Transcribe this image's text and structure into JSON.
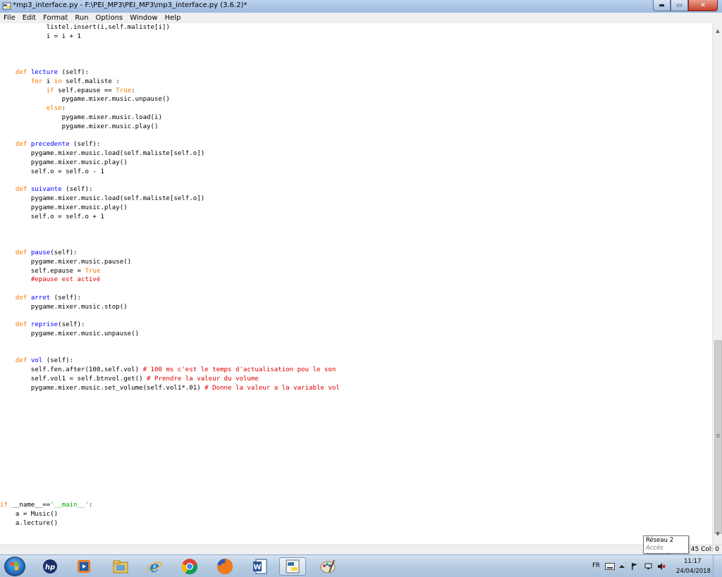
{
  "window": {
    "title": "*mp3_interface.py - F:\\PEI_MP3\\PEI_MP3\\mp3_interface.py (3.6.2)*",
    "controls": {
      "minimize": "▬",
      "maximize": "▭",
      "close": "✕"
    }
  },
  "menu": {
    "items": [
      {
        "label": "File"
      },
      {
        "label": "Edit"
      },
      {
        "label": "Format"
      },
      {
        "label": "Run"
      },
      {
        "label": "Options"
      },
      {
        "label": "Window"
      },
      {
        "label": "Help"
      }
    ]
  },
  "code_lines": [
    [
      [
        "t",
        "            listel.insert(i,self.maliste[i])"
      ]
    ],
    [
      [
        "t",
        "            i = i + 1"
      ]
    ],
    [
      [
        "t",
        ""
      ]
    ],
    [
      [
        "t",
        ""
      ]
    ],
    [
      [
        "t",
        ""
      ]
    ],
    [
      [
        "t",
        "    "
      ],
      [
        "k",
        "def"
      ],
      [
        "t",
        " "
      ],
      [
        "n",
        "lecture"
      ],
      [
        "t",
        " (self):"
      ]
    ],
    [
      [
        "t",
        "        "
      ],
      [
        "k",
        "for"
      ],
      [
        "t",
        " i "
      ],
      [
        "k",
        "in"
      ],
      [
        "t",
        " self.maliste :"
      ]
    ],
    [
      [
        "t",
        "            "
      ],
      [
        "k",
        "if"
      ],
      [
        "t",
        " self.epause == "
      ],
      [
        "k",
        "True"
      ],
      [
        "t",
        ":"
      ]
    ],
    [
      [
        "t",
        "                pygame.mixer.music.unpause()"
      ]
    ],
    [
      [
        "t",
        "            "
      ],
      [
        "k",
        "else"
      ],
      [
        "t",
        ":"
      ]
    ],
    [
      [
        "t",
        "                pygame.mixer.music.load(i)"
      ]
    ],
    [
      [
        "t",
        "                pygame.mixer.music.play()"
      ]
    ],
    [
      [
        "t",
        ""
      ]
    ],
    [
      [
        "t",
        "    "
      ],
      [
        "k",
        "def"
      ],
      [
        "t",
        " "
      ],
      [
        "n",
        "precedente"
      ],
      [
        "t",
        " (self):"
      ]
    ],
    [
      [
        "t",
        "        pygame.mixer.music.load(self.maliste[self.o])"
      ]
    ],
    [
      [
        "t",
        "        pygame.mixer.music.play()"
      ]
    ],
    [
      [
        "t",
        "        self.o = self.o - 1"
      ]
    ],
    [
      [
        "t",
        ""
      ]
    ],
    [
      [
        "t",
        "    "
      ],
      [
        "k",
        "def"
      ],
      [
        "t",
        " "
      ],
      [
        "n",
        "suivante"
      ],
      [
        "t",
        " (self):"
      ]
    ],
    [
      [
        "t",
        "        pygame.mixer.music.load(self.maliste[self.o])"
      ]
    ],
    [
      [
        "t",
        "        pygame.mixer.music.play()"
      ]
    ],
    [
      [
        "t",
        "        self.o = self.o + 1"
      ]
    ],
    [
      [
        "t",
        ""
      ]
    ],
    [
      [
        "t",
        ""
      ]
    ],
    [
      [
        "t",
        ""
      ]
    ],
    [
      [
        "t",
        "    "
      ],
      [
        "k",
        "def"
      ],
      [
        "t",
        " "
      ],
      [
        "n",
        "pause"
      ],
      [
        "t",
        "(self):"
      ]
    ],
    [
      [
        "t",
        "        pygame.mixer.music.pause()"
      ]
    ],
    [
      [
        "t",
        "        self.epause = "
      ],
      [
        "k",
        "True"
      ]
    ],
    [
      [
        "t",
        "        "
      ],
      [
        "c",
        "#epause est activé"
      ]
    ],
    [
      [
        "t",
        ""
      ]
    ],
    [
      [
        "t",
        "    "
      ],
      [
        "k",
        "def"
      ],
      [
        "t",
        " "
      ],
      [
        "n",
        "arret"
      ],
      [
        "t",
        " (self):"
      ]
    ],
    [
      [
        "t",
        "        pygame.mixer.music.stop()"
      ]
    ],
    [
      [
        "t",
        ""
      ]
    ],
    [
      [
        "t",
        "    "
      ],
      [
        "k",
        "def"
      ],
      [
        "t",
        " "
      ],
      [
        "n",
        "reprise"
      ],
      [
        "t",
        "(self):"
      ]
    ],
    [
      [
        "t",
        "        pygame.mixer.music.unpause()"
      ]
    ],
    [
      [
        "t",
        ""
      ]
    ],
    [
      [
        "t",
        ""
      ]
    ],
    [
      [
        "t",
        "    "
      ],
      [
        "k",
        "def"
      ],
      [
        "t",
        " "
      ],
      [
        "n",
        "vol"
      ],
      [
        "t",
        " (self):"
      ]
    ],
    [
      [
        "t",
        "        self.fen.after(100,self.vol) "
      ],
      [
        "c",
        "# 100 ms c'est le temps d'actualisation pou le son"
      ]
    ],
    [
      [
        "t",
        "        self.vol1 = self.btnvol.get() "
      ],
      [
        "c",
        "# Prendre la valeur du volume"
      ]
    ],
    [
      [
        "t",
        "        pygame.mixer.music.set_volume(self.vol1*.01) "
      ],
      [
        "c",
        "# Donne la valeur a la variable vol"
      ]
    ],
    [
      [
        "t",
        ""
      ]
    ],
    [
      [
        "t",
        ""
      ]
    ],
    [
      [
        "t",
        ""
      ]
    ],
    [
      [
        "t",
        ""
      ]
    ],
    [
      [
        "t",
        ""
      ]
    ],
    [
      [
        "t",
        ""
      ]
    ],
    [
      [
        "t",
        ""
      ]
    ],
    [
      [
        "t",
        ""
      ]
    ],
    [
      [
        "t",
        ""
      ]
    ],
    [
      [
        "t",
        ""
      ]
    ],
    [
      [
        "t",
        ""
      ]
    ],
    [
      [
        "t",
        ""
      ]
    ],
    [
      [
        "k",
        "if"
      ],
      [
        "t",
        " __name__=="
      ],
      [
        "s",
        "'__main__'"
      ],
      [
        "t",
        ":"
      ]
    ],
    [
      [
        "t",
        "    a = Music()"
      ]
    ],
    [
      [
        "t",
        "    a.lecture()"
      ]
    ]
  ],
  "statusbar": {
    "position": "45   Col: 0"
  },
  "tooltip": {
    "line1": "Réseau  2",
    "line2": "Accès Internet"
  },
  "taskbar": {
    "icons": [
      {
        "name": "hp-icon"
      },
      {
        "name": "media-player-icon"
      },
      {
        "name": "file-explorer-icon"
      },
      {
        "name": "internet-explorer-icon"
      },
      {
        "name": "chrome-icon"
      },
      {
        "name": "firefox-icon"
      },
      {
        "name": "word-icon"
      },
      {
        "name": "python-idle-icon",
        "active": true
      },
      {
        "name": "paint-icon"
      }
    ],
    "language": "FR",
    "time": "11:17",
    "date": "24/04/2018"
  },
  "colors": {
    "keyword": "#ff7700",
    "def_name": "#0000ff",
    "string": "#00aa00",
    "comment": "#dd0000"
  }
}
